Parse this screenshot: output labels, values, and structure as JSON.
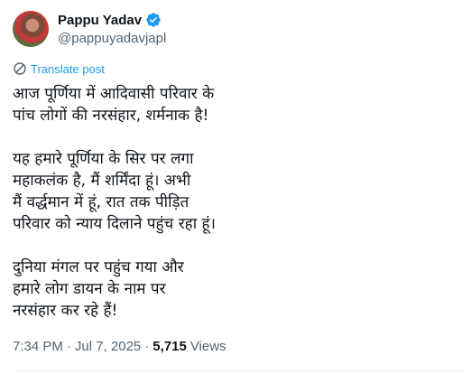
{
  "author": {
    "name": "Pappu Yadav",
    "handle": "@pappuyadavjapl"
  },
  "translate_label": "Translate post",
  "post": {
    "paragraphs": [
      {
        "lines": [
          "आज पूर्णिया में आदिवासी परिवार के",
          "पांच लोगों की नरसंहार, शर्मनाक है!"
        ]
      },
      {
        "lines": [
          "यह हमारे पूर्णिया के सिर पर लगा",
          "महाकलंक है, मैं शर्मिंदा हूं। अभी",
          "मैं वर्द्धमान में हूं, रात तक पीड़ित",
          "परिवार को न्याय दिलाने पहुंच रहा हूं।"
        ]
      },
      {
        "lines": [
          "दुनिया मंगल पर पहुंच गया और",
          "हमारे लोग डायन के नाम पर",
          "नरसंहार कर रहे हैं!"
        ]
      }
    ]
  },
  "meta": {
    "time": "7:34 PM",
    "separator": "·",
    "date": "Jul 7, 2025",
    "views_count": "5,715",
    "views_label": "Views"
  },
  "colors": {
    "accent": "#1d9bf0",
    "text": "#0f1419",
    "secondary": "#536471"
  },
  "icons": {
    "verified": "verified-badge-icon",
    "translate": "globe-icon"
  }
}
